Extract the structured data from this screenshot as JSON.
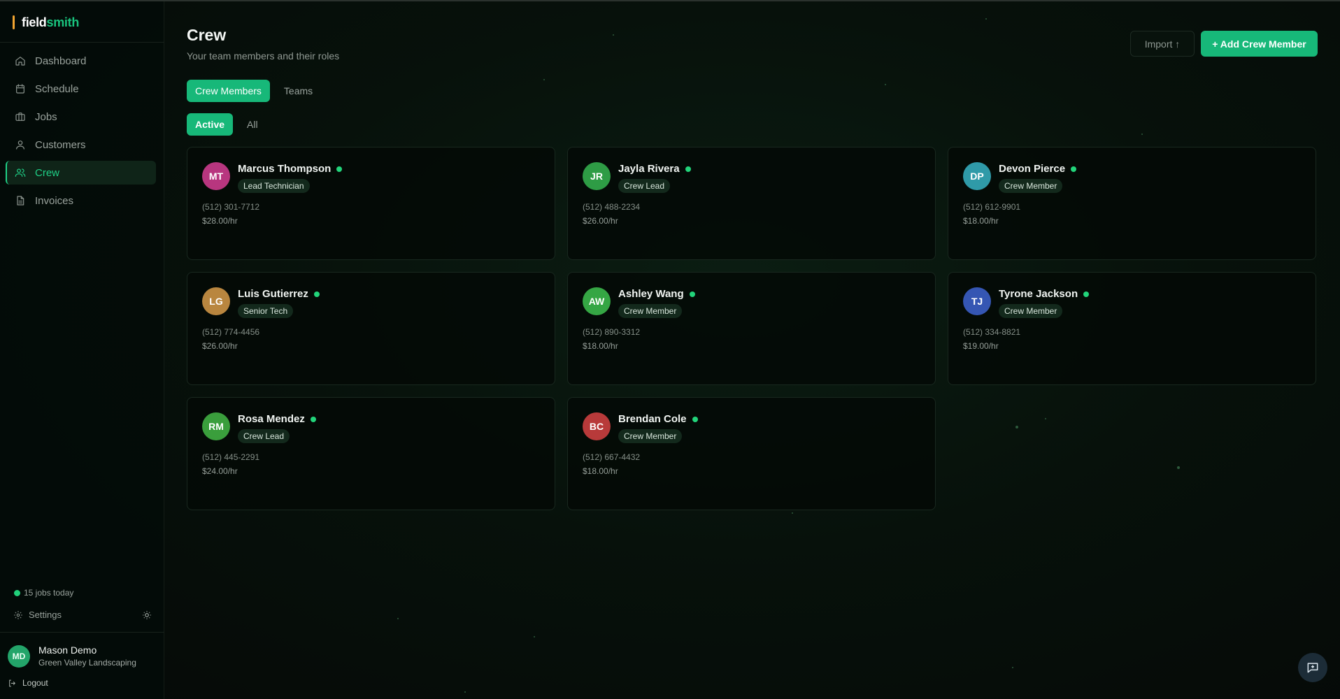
{
  "brand": {
    "name_part1": "field",
    "name_part2": "smith"
  },
  "nav": [
    {
      "label": "Dashboard",
      "icon": "home-icon",
      "active": false
    },
    {
      "label": "Schedule",
      "icon": "calendar-icon",
      "active": false
    },
    {
      "label": "Jobs",
      "icon": "briefcase-icon",
      "active": false
    },
    {
      "label": "Customers",
      "icon": "user-icon",
      "active": false
    },
    {
      "label": "Crew",
      "icon": "users-icon",
      "active": true
    },
    {
      "label": "Invoices",
      "icon": "file-icon",
      "active": false
    }
  ],
  "sidebar_footer": {
    "jobs_today": "15 jobs today",
    "settings_label": "Settings",
    "user": {
      "initials": "MD",
      "name": "Mason Demo",
      "org": "Green Valley Landscaping"
    },
    "logout_label": "Logout"
  },
  "header": {
    "title": "Crew",
    "subtitle": "Your team members and their roles",
    "import_label": "Import ↑",
    "add_label": "+ Add Crew Member"
  },
  "tabs": [
    "Crew Members",
    "Teams"
  ],
  "filters": [
    "Active",
    "All"
  ],
  "crew": [
    {
      "initials": "MT",
      "name": "Marcus Thompson",
      "role": "Lead Technician",
      "phone": "(512) 301-7712",
      "rate": "$28.00/hr",
      "color": "#b8367f"
    },
    {
      "initials": "JR",
      "name": "Jayla Rivera",
      "role": "Crew Lead",
      "phone": "(512) 488-2234",
      "rate": "$26.00/hr",
      "color": "#2e9c45"
    },
    {
      "initials": "DP",
      "name": "Devon Pierce",
      "role": "Crew Member",
      "phone": "(512) 612-9901",
      "rate": "$18.00/hr",
      "color": "#2f9aa8"
    },
    {
      "initials": "LG",
      "name": "Luis Gutierrez",
      "role": "Senior Tech",
      "phone": "(512) 774-4456",
      "rate": "$26.00/hr",
      "color": "#b9863f"
    },
    {
      "initials": "AW",
      "name": "Ashley Wang",
      "role": "Crew Member",
      "phone": "(512) 890-3312",
      "rate": "$18.00/hr",
      "color": "#35a644"
    },
    {
      "initials": "TJ",
      "name": "Tyrone Jackson",
      "role": "Crew Member",
      "phone": "(512) 334-8821",
      "rate": "$19.00/hr",
      "color": "#3556b3"
    },
    {
      "initials": "RM",
      "name": "Rosa Mendez",
      "role": "Crew Lead",
      "phone": "(512) 445-2291",
      "rate": "$24.00/hr",
      "color": "#3a9e3c"
    },
    {
      "initials": "BC",
      "name": "Brendan Cole",
      "role": "Crew Member",
      "phone": "(512) 667-4432",
      "rate": "$18.00/hr",
      "color": "#b83a3a"
    }
  ],
  "colors": {
    "accent": "#17b879",
    "status_active": "#22d47a"
  }
}
